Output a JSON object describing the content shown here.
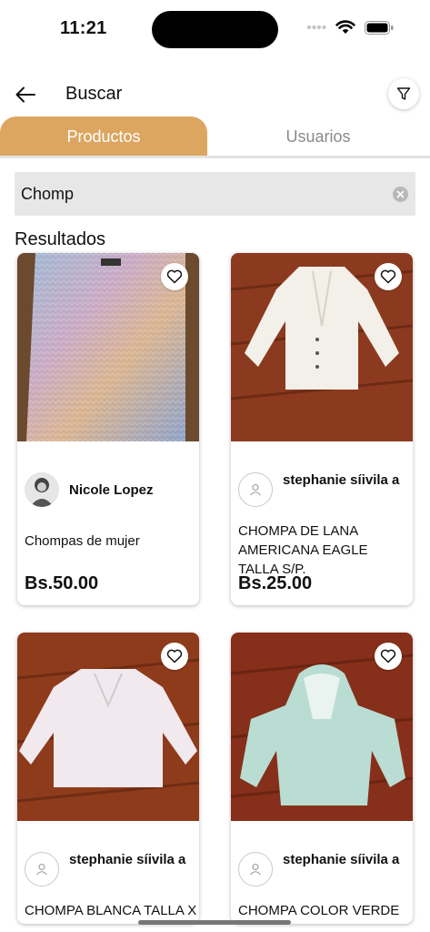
{
  "status_bar": {
    "time": "11:21"
  },
  "header": {
    "title": "Buscar"
  },
  "tabs": [
    {
      "label": "Productos",
      "active": true
    },
    {
      "label": "Usuarios",
      "active": false
    }
  ],
  "search": {
    "value": "Chomp"
  },
  "results_title": "Resultados",
  "colors": {
    "accent": "#dca661"
  },
  "products": [
    {
      "seller": "Nicole Lopez",
      "title": "Chompas de mujer",
      "price": "Bs.50.00"
    },
    {
      "seller": "stephanie síivila a",
      "title": "CHOMPA DE LANA AMERICANA EAGLE TALLA S/P.",
      "price": "Bs.25.00"
    },
    {
      "seller": "stephanie síivila a",
      "title": "CHOMPA BLANCA TALLA X",
      "price": ""
    },
    {
      "seller": "stephanie síivila a",
      "title": "CHOMPA COLOR VERDE A",
      "price": ""
    }
  ]
}
